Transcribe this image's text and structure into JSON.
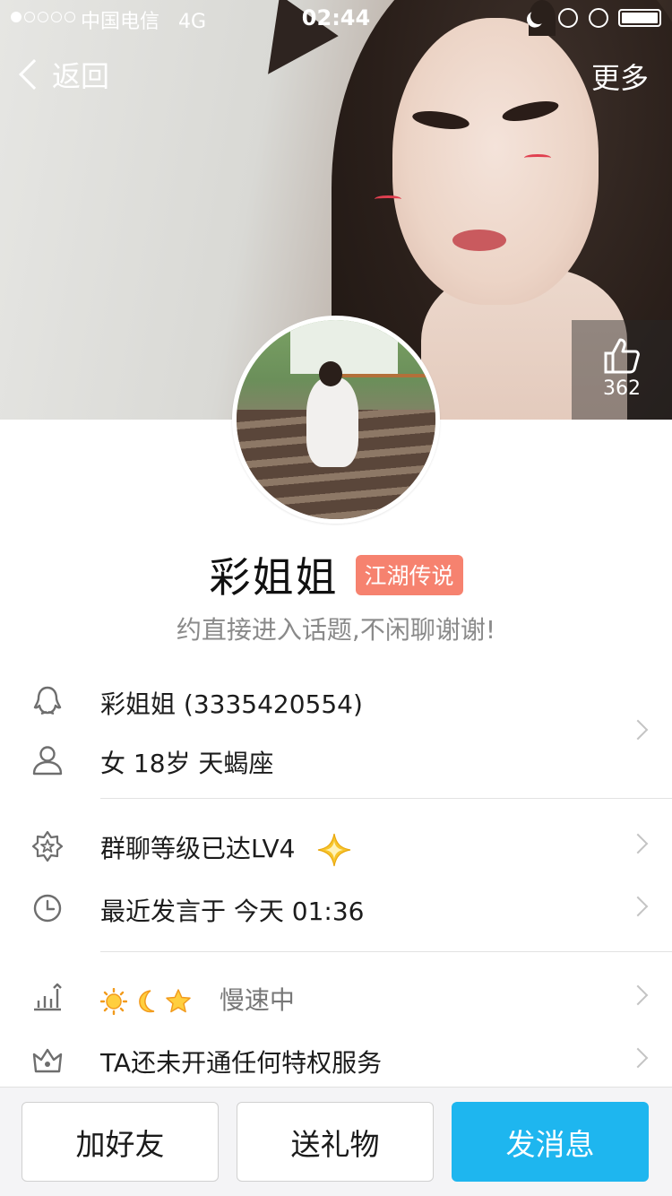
{
  "status_bar": {
    "carrier": "中国电信",
    "network": "4G",
    "time": "02:44"
  },
  "nav": {
    "back_label": "返回",
    "more_label": "更多"
  },
  "like": {
    "count": "362",
    "icon": "thumbs-up-icon"
  },
  "profile": {
    "nickname": "彩姐姐",
    "badge": "江湖传说",
    "signature": "约直接进入话题,不闲聊谢谢!"
  },
  "rows": {
    "qq": "彩姐姐 (3335420554)",
    "basic": "女 18岁 天蝎座",
    "group_level": "群聊等级已达LV4",
    "last_active": "最近发言于 今天 01:36",
    "speed_label": "慢速中",
    "privilege": "TA还未开通任何特权服务"
  },
  "buttons": {
    "add_friend": "加好友",
    "send_gift": "送礼物",
    "send_message": "发消息"
  },
  "colors": {
    "badge_bg": "#f6826f",
    "primary_button": "#1eb6ef"
  }
}
